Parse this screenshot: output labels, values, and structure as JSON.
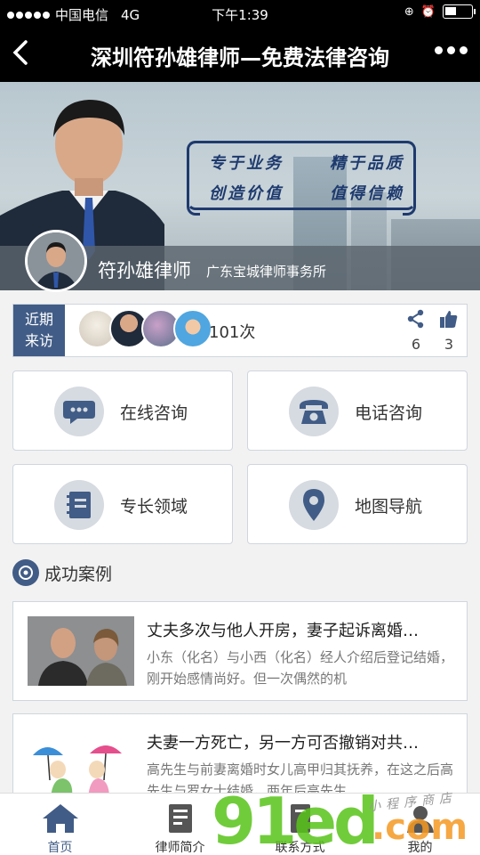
{
  "status_bar": {
    "carrier": "中国电信",
    "network": "4G",
    "time": "下午1:39"
  },
  "nav": {
    "title": "深圳符孙雄律师—免费法律咨询"
  },
  "banner": {
    "slogan_row1_left": "专于业务",
    "slogan_row1_right": "精于品质",
    "slogan_row2_left": "创造价值",
    "slogan_row2_right": "值得信赖",
    "lawyer_name": "符孙雄律师",
    "firm": "广东宝城律师事务所"
  },
  "visitors": {
    "label_line1": "近期",
    "label_line2": "来访",
    "count": "101次",
    "shares": "6",
    "likes": "3"
  },
  "grid": {
    "online": "在线咨询",
    "phone": "电话咨询",
    "expertise": "专长领域",
    "map": "地图导航"
  },
  "cases_section": {
    "title": "成功案例"
  },
  "cases": [
    {
      "title": "丈夫多次与他人开房，妻子起诉离婚…",
      "desc": "小东（化名）与小西（化名）经人介绍后登记结婚，刚开始感情尚好。但一次偶然的机"
    },
    {
      "title": "夫妻一方死亡，另一方可否撤销对共…",
      "desc": "高先生与前妻离婚时女儿高甲归其抚养，在这之后高先生与罗女士结婚，两年后高先生"
    }
  ],
  "tabbar": {
    "home": "首页",
    "profile": "律师简介",
    "contact": "联系方式",
    "mine": "我的"
  },
  "watermark": {
    "brand": "91ed",
    "suffix": ".com",
    "shop": "小程序商店"
  },
  "colors": {
    "accent": "#415c86",
    "nav_bg": "#000000",
    "icon_circle": "#d6dbe1"
  }
}
